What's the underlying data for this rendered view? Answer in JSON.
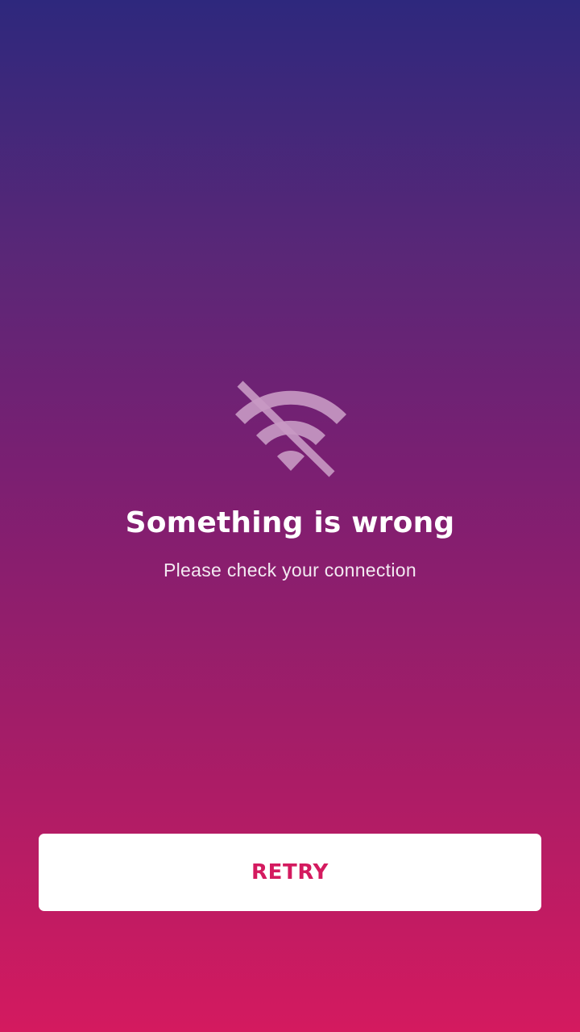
{
  "error_screen": {
    "icon": "wifi-off-icon",
    "title": "Something is wrong",
    "message": "Please check your connection",
    "retry_label": "RETRY"
  },
  "colors": {
    "gradient_top": "#2e287d",
    "gradient_bottom": "#d41a5f",
    "accent": "#d41a5f",
    "icon_tint": "#c89ac4"
  }
}
